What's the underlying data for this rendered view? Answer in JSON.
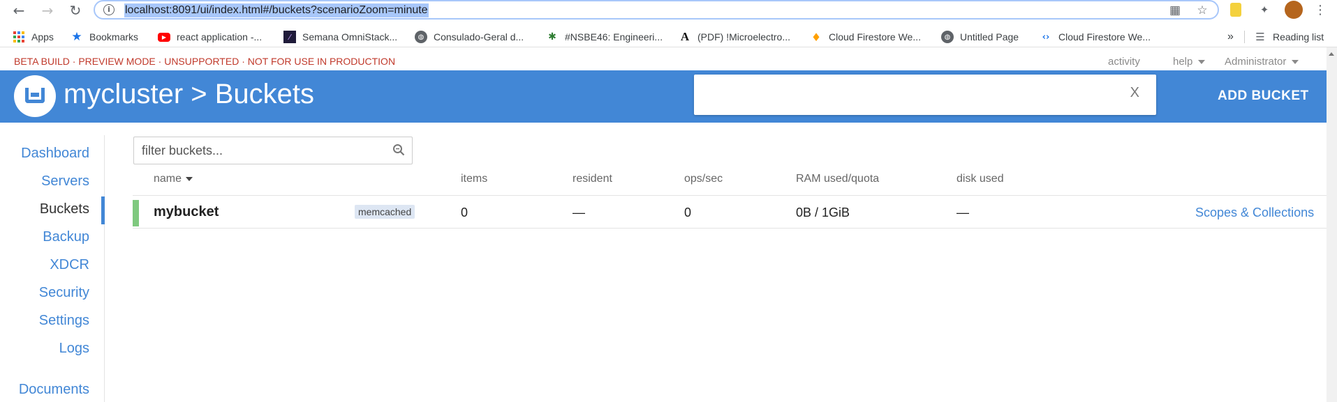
{
  "browser": {
    "url": "localhost:8091/ui/index.html#/buckets?scenarioZoom=minute",
    "bookmarks": [
      {
        "label": "Apps",
        "icon": "apps-grid-icon"
      },
      {
        "label": "Bookmarks",
        "icon": "star-icon"
      },
      {
        "label": "react application -...",
        "icon": "youtube-icon"
      },
      {
        "label": "Semana OmniStack...",
        "icon": "site-icon"
      },
      {
        "label": "Consulado-Geral d...",
        "icon": "globe-icon"
      },
      {
        "label": "#NSBE46: Engineeri...",
        "icon": "figure-icon"
      },
      {
        "label": "(PDF) !Microelectro...",
        "icon": "letter-a-icon"
      },
      {
        "label": "Cloud Firestore We...",
        "icon": "firebase-icon"
      },
      {
        "label": "Untitled Page",
        "icon": "globe-icon"
      },
      {
        "label": "Cloud Firestore We...",
        "icon": "code-icon"
      }
    ],
    "more_label": "»",
    "reading_list_label": "Reading list"
  },
  "app": {
    "beta_banner": "BETA BUILD · PREVIEW MODE · UNSUPPORTED · NOT FOR USE IN PRODUCTION",
    "top_links": {
      "activity": "activity",
      "help": "help",
      "user": "Administrator"
    },
    "header": {
      "title": "mycluster > Buckets",
      "search_close": "X",
      "add_bucket": "ADD BUCKET"
    },
    "sidebar": {
      "items": [
        "Dashboard",
        "Servers",
        "Buckets",
        "Backup",
        "XDCR",
        "Security",
        "Settings",
        "Logs",
        "Documents"
      ],
      "active": "Buckets"
    },
    "filter": {
      "placeholder": "filter buckets..."
    },
    "table": {
      "columns": {
        "name": "name",
        "items": "items",
        "resident": "resident",
        "ops": "ops/sec",
        "ram": "RAM used/quota",
        "disk": "disk used"
      },
      "rows": [
        {
          "name": "mybucket",
          "type": "memcached",
          "items": "0",
          "resident": "—",
          "ops": "0",
          "ram": "0B / 1GiB",
          "disk": "—",
          "link": "Scopes & Collections",
          "status_color": "#7fc97f"
        }
      ]
    },
    "colors": {
      "accent": "#4287d6",
      "beta": "#c0392b"
    }
  }
}
